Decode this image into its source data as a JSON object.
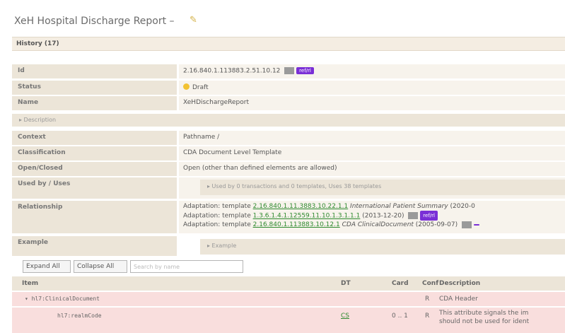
{
  "title": "XeH Hospital Discharge Report –",
  "history": "History (17)",
  "fields": {
    "id_label": "Id",
    "id_value": "2.16.840.1.113883.2.51.10.12",
    "id_badge": "ref/rl",
    "status_label": "Status",
    "status_value": "Draft",
    "name_label": "Name",
    "name_value": "XeHDischargeReport",
    "description_toggle": "▸ Description",
    "context_label": "Context",
    "context_value": "Pathname /",
    "classification_label": "Classification",
    "classification_value": "CDA Document Level Template",
    "openclosed_label": "Open/Closed",
    "openclosed_value": "Open (other than defined elements are allowed)",
    "usedby_label": "Used by / Uses",
    "usedby_value": "▸ Used by 0 transactions and 0 templates, Uses 38 templates",
    "relationship_label": "Relationship",
    "example_label": "Example",
    "example_value": "▸ Example"
  },
  "relationships": [
    {
      "prefix": "Adaptation: template",
      "oid": "2.16.840.1.11.3883.10.22.1.1",
      "name": "International Patient Summary",
      "date": "(2020-0"
    },
    {
      "prefix": "Adaptation: template",
      "oid": "1.3.6.1.4.1.12559.11.10.1.3.1.1.1",
      "name": "",
      "date": "(2013-12-20)",
      "badge": "ref/rl"
    },
    {
      "prefix": "Adaptation: template",
      "oid": "2.16.840.1.113883.10.12.1",
      "name": "CDA ClinicalDocument",
      "date": "(2005-09-07)"
    }
  ],
  "toolbar": {
    "expand_all": "Expand All",
    "collapse_all": "Collapse All",
    "search_placeholder": "Search by name"
  },
  "table": {
    "headers": {
      "item": "Item",
      "dt": "DT",
      "card": "Card",
      "conf": "Conf",
      "description": "Description"
    },
    "rows": [
      {
        "item": "▾ hl7:ClinicalDocument",
        "dt": "",
        "card": "",
        "conf": "R",
        "description": "CDA Header"
      },
      {
        "item": "hl7:realmCode",
        "dt": "CS",
        "card": "0 .. 1",
        "conf": "R",
        "description": "This attribute signals the im",
        "description2": "should not be used for ident"
      }
    ]
  },
  "colors": {
    "label_bg": "#ece5d8",
    "value_bg": "#f7f3ec",
    "badge": "#7a2fd6",
    "link": "#2f8a2f",
    "row_pink": "#f9dedd"
  }
}
